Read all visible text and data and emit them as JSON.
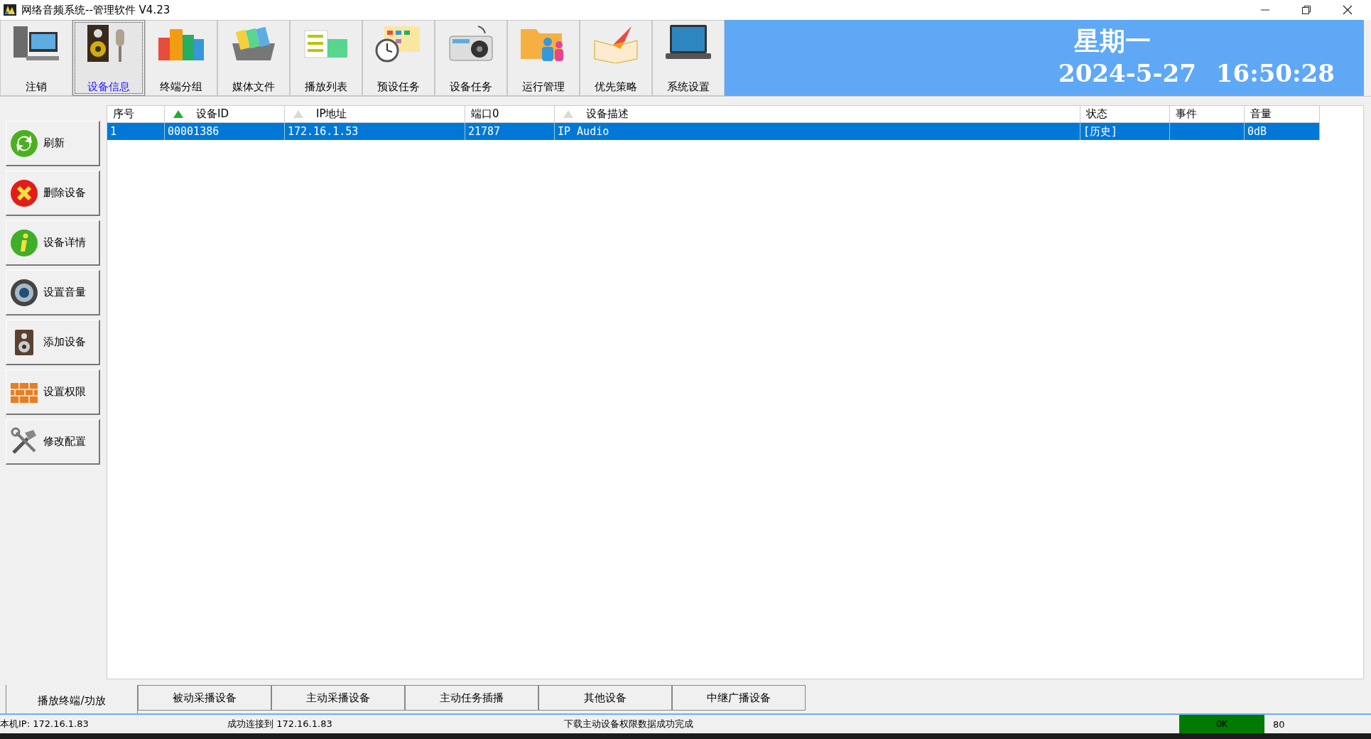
{
  "window": {
    "title": "网络音频系统--管理软件  V4.23"
  },
  "toolbar": [
    {
      "label": "注销",
      "kind": "computer",
      "selected": false
    },
    {
      "label": "设备信息",
      "kind": "speaker",
      "selected": true
    },
    {
      "label": "终端分组",
      "kind": "buildings",
      "selected": false
    },
    {
      "label": "媒体文件",
      "kind": "folders",
      "selected": false
    },
    {
      "label": "播放列表",
      "kind": "list",
      "selected": false
    },
    {
      "label": "预设任务",
      "kind": "calendar",
      "selected": false
    },
    {
      "label": "设备任务",
      "kind": "radio",
      "selected": false
    },
    {
      "label": "运行管理",
      "kind": "people",
      "selected": false
    },
    {
      "label": "优先策略",
      "kind": "book",
      "selected": false
    },
    {
      "label": "系统设置",
      "kind": "laptop",
      "selected": false
    }
  ],
  "clock": {
    "weekday": "星期一",
    "date": "2024-5-27",
    "time": "16:50:28"
  },
  "sidebar": [
    {
      "label": "刷新",
      "kind": "refresh"
    },
    {
      "label": "删除设备",
      "kind": "delete"
    },
    {
      "label": "设备详情",
      "kind": "info"
    },
    {
      "label": "设置音量",
      "kind": "volume"
    },
    {
      "label": "添加设备",
      "kind": "speaker"
    },
    {
      "label": "设置权限",
      "kind": "wall"
    },
    {
      "label": "修改配置",
      "kind": "tools"
    }
  ],
  "table": {
    "columns": [
      {
        "label": "序号"
      },
      {
        "label": "设备ID",
        "sorted": true
      },
      {
        "label": "IP地址",
        "sorted": false
      },
      {
        "label": "端口0"
      },
      {
        "label": "设备描述",
        "sorted": false
      },
      {
        "label": "状态"
      },
      {
        "label": "事件"
      },
      {
        "label": "音量"
      }
    ],
    "rows": [
      {
        "selected": true,
        "cells": [
          "1",
          "00001386",
          "172.16.1.53",
          "21787",
          "IP Audio",
          "[历史]",
          "",
          "0dB"
        ]
      }
    ]
  },
  "bottom_tabs": [
    {
      "label": "播放终端/功放",
      "selected": true
    },
    {
      "label": "被动采播设备",
      "selected": false
    },
    {
      "label": "主动采播设备",
      "selected": false
    },
    {
      "label": "主动任务插播",
      "selected": false
    },
    {
      "label": "其他设备",
      "selected": false
    },
    {
      "label": "中继广播设备",
      "selected": false
    }
  ],
  "status_bar": {
    "local_ip": "本机IP: 172.16.1.83",
    "connection": "成功连接到 172.16.1.83",
    "message": "下载主动设备权限数据成功完成",
    "state": "OK",
    "value": "80"
  }
}
